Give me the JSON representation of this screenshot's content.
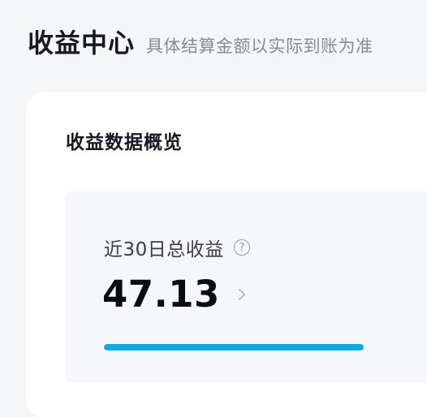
{
  "header": {
    "title": "收益中心",
    "subtitle": "具体结算金额以实际到账为准"
  },
  "overview": {
    "title": "收益数据概览",
    "stat": {
      "label": "近30日总收益",
      "help_icon": "question-circle-icon",
      "help_glyph": "?",
      "value": "47.13",
      "more_icon": "chevron-right-icon",
      "progress_fraction": 1.0,
      "progress_color": "#0fa9e6"
    }
  }
}
